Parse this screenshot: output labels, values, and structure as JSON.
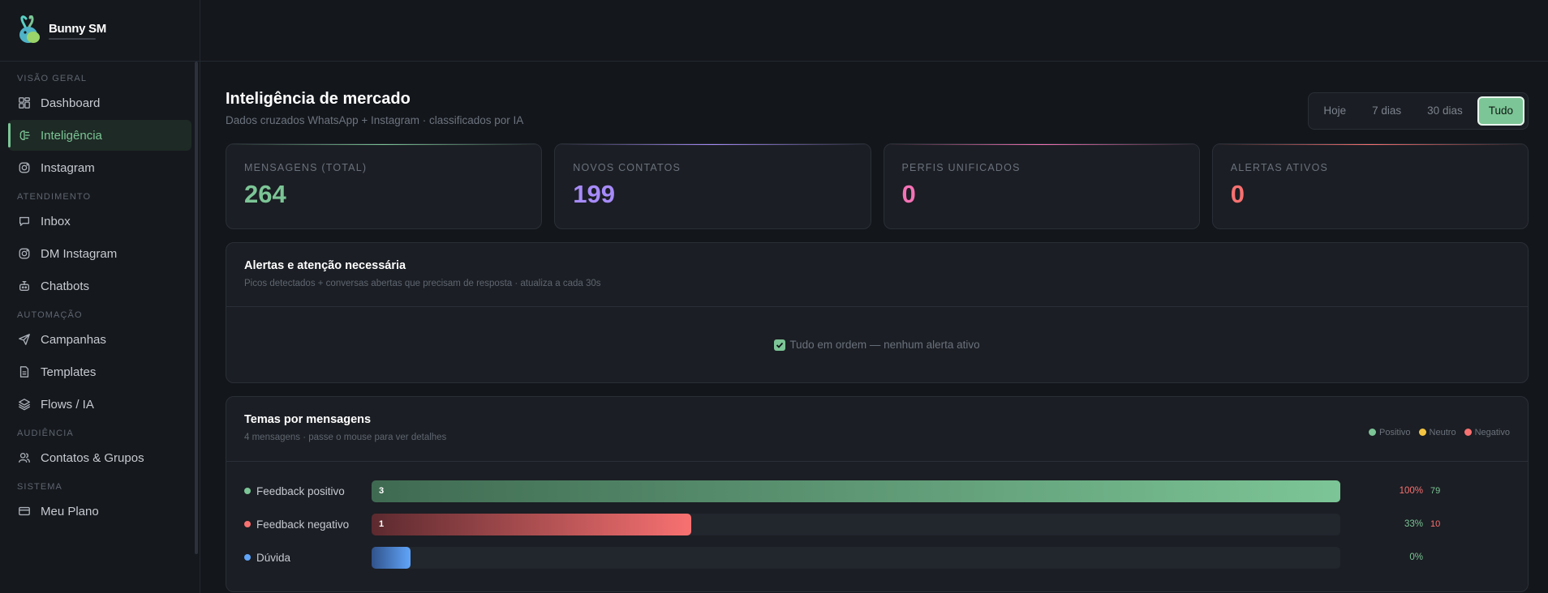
{
  "brand": {
    "name": "Bunny SM"
  },
  "sidebar": {
    "sections": [
      {
        "title": "Visão geral",
        "items": [
          {
            "label": "Dashboard",
            "icon": "dashboard-icon"
          },
          {
            "label": "Inteligência",
            "icon": "brain-icon",
            "active": true
          },
          {
            "label": "Instagram",
            "icon": "instagram-icon"
          }
        ]
      },
      {
        "title": "Atendimento",
        "items": [
          {
            "label": "Inbox",
            "icon": "chat-icon"
          },
          {
            "label": "DM Instagram",
            "icon": "instagram-icon"
          },
          {
            "label": "Chatbots",
            "icon": "robot-icon"
          }
        ]
      },
      {
        "title": "Automação",
        "items": [
          {
            "label": "Campanhas",
            "icon": "send-icon"
          },
          {
            "label": "Templates",
            "icon": "file-icon"
          },
          {
            "label": "Flows / IA",
            "icon": "layers-icon"
          }
        ]
      },
      {
        "title": "Audiência",
        "items": [
          {
            "label": "Contatos & Grupos",
            "icon": "users-icon"
          }
        ]
      },
      {
        "title": "Sistema",
        "items": [
          {
            "label": "Meu Plano",
            "icon": "card-icon"
          }
        ]
      }
    ]
  },
  "page": {
    "title": "Inteligência de mercado",
    "subtitle": "Dados cruzados WhatsApp + Instagram · classificados por IA"
  },
  "range": {
    "options": [
      "Hoje",
      "7 dias",
      "30 dias",
      "Tudo"
    ],
    "selected": "Tudo"
  },
  "kpis": [
    {
      "label": "Mensagens (total)",
      "value": "264",
      "color": "#7cc596",
      "bar": "linear-gradient(90deg, transparent, #7cc596, transparent)"
    },
    {
      "label": "Novos contatos",
      "value": "199",
      "color": "#a78bfa",
      "bar": "linear-gradient(90deg, transparent, #a78bfa, transparent)"
    },
    {
      "label": "Perfis unificados",
      "value": "0",
      "color": "#f472b6",
      "bar": "linear-gradient(90deg, transparent, #f472b6, transparent)"
    },
    {
      "label": "Alertas ativos",
      "value": "0",
      "color": "#f87171",
      "bar": "linear-gradient(90deg, transparent, #f87171, transparent)"
    }
  ],
  "alerts": {
    "title": "Alertas e atenção necessária",
    "subtitle": "Picos detectados + conversas abertas que precisam de resposta · atualiza a cada 30s",
    "empty": "Tudo em ordem — nenhum alerta ativo"
  },
  "themes": {
    "title": "Temas por mensagens",
    "subtitle": "4 mensagens · passe o mouse para ver detalhes",
    "legend": [
      {
        "label": "Positivo",
        "color": "#7cc596"
      },
      {
        "label": "Neutro",
        "color": "#f5c542"
      },
      {
        "label": "Negativo",
        "color": "#f87171"
      }
    ],
    "rows": [
      {
        "name": "Feedback positivo",
        "dot": "#7cc596",
        "count_label": "3",
        "fraction": 1.0,
        "gradient": "linear-gradient(90deg, #3f6a52, #7cc596)",
        "pct": "100%",
        "pct_color": "#f87171",
        "extra": "79",
        "extra_color": "#7cc596"
      },
      {
        "name": "Feedback negativo",
        "dot": "#f87171",
        "count_label": "1",
        "fraction": 0.33,
        "gradient": "linear-gradient(90deg, #5c2a2f, #f87171)",
        "pct": "33%",
        "pct_color": "#7cc596",
        "extra": "10",
        "extra_color": "#f87171"
      },
      {
        "name": "Dúvida",
        "dot": "#60a5fa",
        "count_label": "",
        "fraction": 0.04,
        "gradient": "linear-gradient(90deg, #31528a, #60a5fa)",
        "pct": "0%",
        "pct_color": "#7cc596",
        "extra": "",
        "extra_color": "#7cc596"
      }
    ]
  }
}
